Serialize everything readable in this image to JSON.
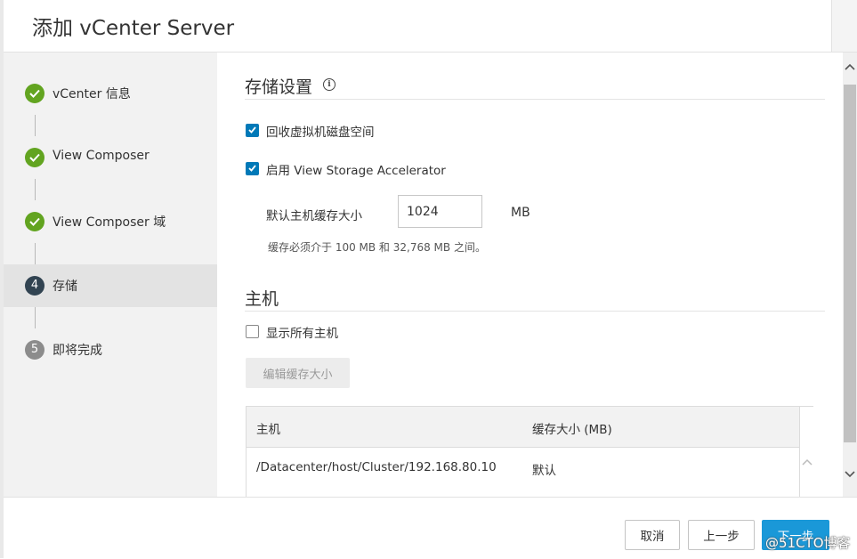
{
  "dialog": {
    "title": "添加 vCenter Server"
  },
  "steps": [
    {
      "number": "",
      "label": "vCenter 信息",
      "state": "done"
    },
    {
      "number": "",
      "label": "View Composer",
      "state": "done"
    },
    {
      "number": "",
      "label": "View Composer 域",
      "state": "done"
    },
    {
      "number": "4",
      "label": "存储",
      "state": "current"
    },
    {
      "number": "5",
      "label": "即将完成",
      "state": "pending"
    }
  ],
  "storage": {
    "title": "存储设置",
    "info_icon": "i",
    "reclaim_label": "回收虚拟机磁盘空间",
    "reclaim_checked": true,
    "accelerator_label": "启用 View Storage Accelerator",
    "accelerator_checked": true,
    "cache_size_label": "默认主机缓存大小",
    "cache_size_value": "1024",
    "cache_unit": "MB",
    "cache_hint": "缓存必须介于 100 MB 和 32,768 MB 之间。"
  },
  "hosts": {
    "title": "主机",
    "show_all_label": "显示所有主机",
    "show_all_checked": false,
    "edit_button": "编辑缓存大小",
    "columns": [
      "主机",
      "缓存大小 (MB)"
    ],
    "rows": [
      [
        "/Datacenter/host/Cluster/192.168.80.10",
        "默认"
      ]
    ]
  },
  "footer": {
    "cancel": "取消",
    "back": "上一步",
    "next": "下一步"
  },
  "watermark": "@51CTO博客",
  "colors": {
    "step_done": "#62a420",
    "step_current": "#314351",
    "step_pending": "#8c8c8c",
    "checkbox": "#0079b8",
    "primary": "#1a98d8"
  }
}
